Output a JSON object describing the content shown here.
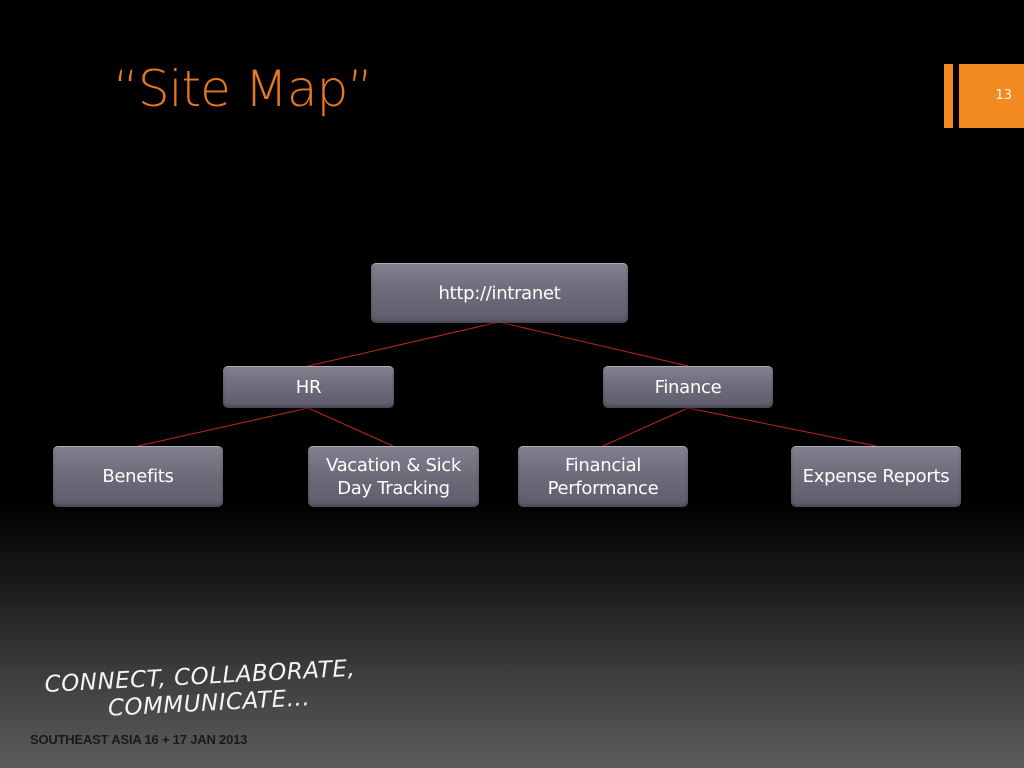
{
  "slide": {
    "title": "“Site Map”",
    "number": "13"
  },
  "sitemap": {
    "root": "http://intranet",
    "level1": [
      "HR",
      "Finance"
    ],
    "level2": [
      "Benefits",
      "Vacation & Sick Day Tracking",
      "Financial Performance",
      "Expense Reports"
    ]
  },
  "footer": {
    "tagline_line1": "CONNECT, COLLABORATE,",
    "tagline_line2": "COMMUNICATE...",
    "event": "SOUTHEAST ASIA 16 + 17 JAN 2013"
  },
  "colors": {
    "accent": "#f28a22",
    "title": "#e8781e",
    "connector": "#c0281a",
    "node": "#6f6c7b"
  }
}
